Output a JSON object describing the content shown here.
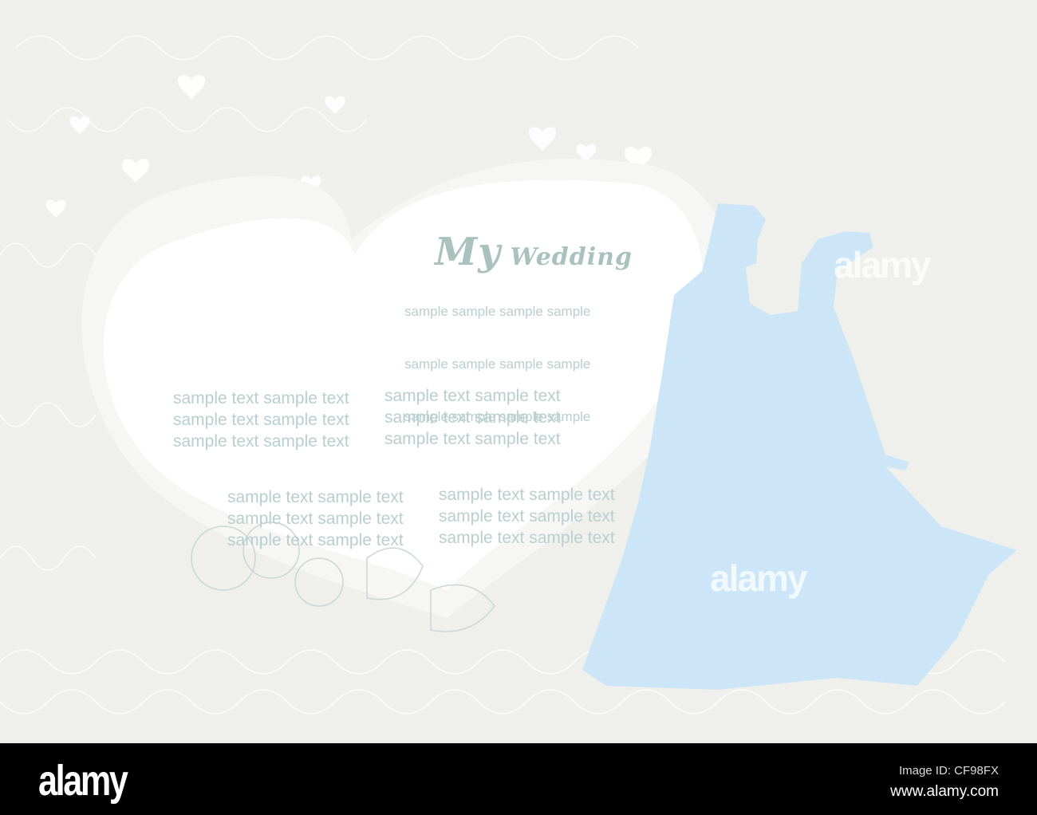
{
  "card": {
    "title": "My Wedding",
    "title_first": "My",
    "title_rest": " Wedding",
    "sample_lines": [
      "sample sample sample sample",
      "sample sample sample sample",
      "sample sample sample sample"
    ],
    "block_a": [
      "sample text sample text",
      "sample text sample text",
      "sample text sample text"
    ],
    "block_b": [
      "sample text sample text",
      "sample text sample text",
      "sample text sample text"
    ],
    "block_c": [
      "sample text sample text",
      "sample text sample text",
      "sample text sample text"
    ],
    "block_d": [
      "sample text sample text",
      "sample text sample text",
      "sample text sample text"
    ],
    "watermark": "alamy"
  },
  "colors": {
    "background": "#eff0eb",
    "heart": "#ffffff",
    "couple": "#cce6f7",
    "text": "#b9cfce"
  },
  "footer": {
    "logo": "alamy",
    "image_id": "Image ID: CF98FX",
    "url": "www.alamy.com"
  }
}
